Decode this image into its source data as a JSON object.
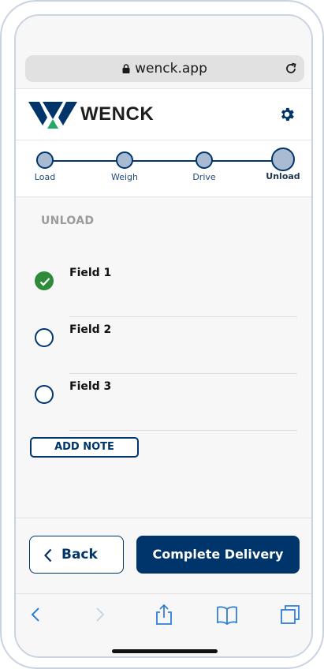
{
  "browser": {
    "url": "wenck.app"
  },
  "header": {
    "brand": "WENCK"
  },
  "stepper": {
    "steps": [
      {
        "label": "Load",
        "active": false
      },
      {
        "label": "Weigh",
        "active": false
      },
      {
        "label": "Drive",
        "active": false
      },
      {
        "label": "Unload",
        "active": true
      }
    ]
  },
  "section": {
    "title": "UNLOAD"
  },
  "fields": [
    {
      "label": "Field 1",
      "completed": true
    },
    {
      "label": "Field 2",
      "completed": false
    },
    {
      "label": "Field 3",
      "completed": false
    }
  ],
  "actions": {
    "add_note": "ADD NOTE",
    "back": "Back",
    "complete": "Complete Delivery"
  },
  "colors": {
    "primary": "#00356b",
    "step_fill": "#a8bbd3",
    "success": "#2e8b3a",
    "logo_green": "#22a96a",
    "muted": "#9b9b9b"
  }
}
